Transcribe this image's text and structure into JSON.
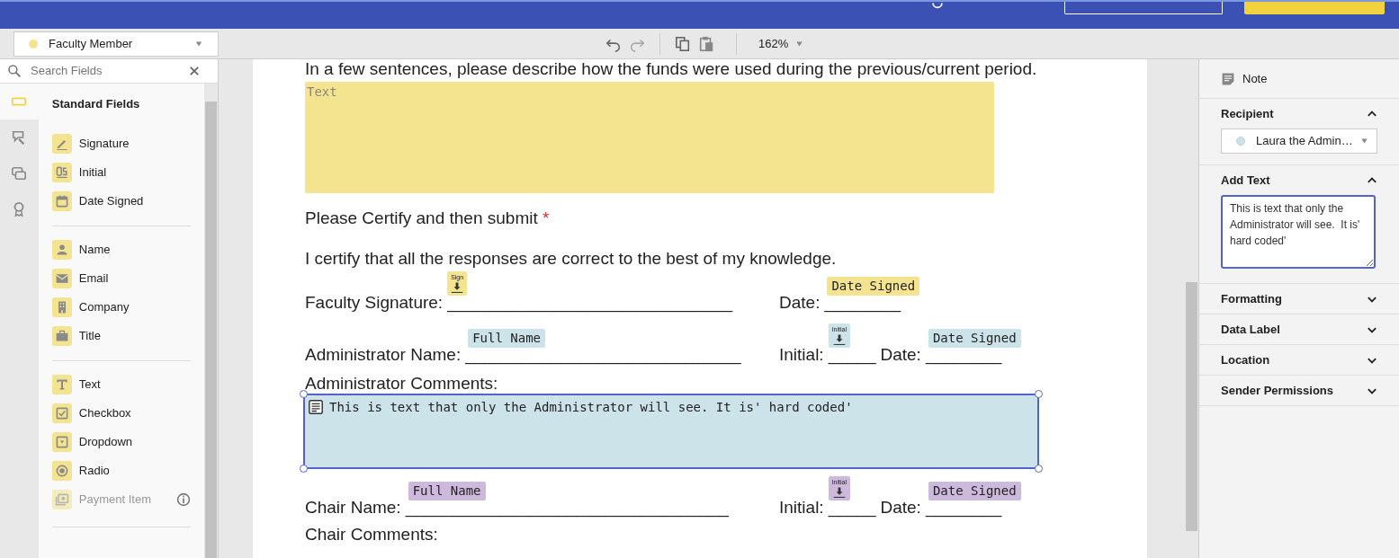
{
  "toolbar": {
    "recipient": {
      "label": "Faculty Member",
      "color": "#f4e48f"
    },
    "zoom": "162%"
  },
  "field_panel": {
    "search": {
      "placeholder": "Search Fields"
    },
    "rail": [
      {
        "selected": true
      },
      {
        "selected": false
      },
      {
        "selected": false
      },
      {
        "selected": false
      }
    ],
    "title": "Standard Fields",
    "groups": [
      {
        "items": [
          {
            "kind": "signature",
            "label": "Signature",
            "disabled": false
          },
          {
            "kind": "initial",
            "label": "Initial",
            "disabled": false
          },
          {
            "kind": "date",
            "label": "Date Signed",
            "disabled": false
          }
        ]
      },
      {
        "items": [
          {
            "kind": "name",
            "label": "Name",
            "disabled": false
          },
          {
            "kind": "email",
            "label": "Email",
            "disabled": false
          },
          {
            "kind": "company",
            "label": "Company",
            "disabled": false
          },
          {
            "kind": "title",
            "label": "Title",
            "disabled": false
          }
        ]
      },
      {
        "items": [
          {
            "kind": "text",
            "label": "Text",
            "disabled": false
          },
          {
            "kind": "checkbox",
            "label": "Checkbox",
            "disabled": false
          },
          {
            "kind": "dropdown",
            "label": "Dropdown",
            "disabled": false
          },
          {
            "kind": "radio",
            "label": "Radio",
            "disabled": false
          },
          {
            "kind": "payment",
            "label": "Payment Item",
            "disabled": true
          }
        ]
      }
    ]
  },
  "document": {
    "blocks": [
      {
        "kind": "paragraph",
        "text": "In a few sentences, please describe how the funds were used during the previous/current period."
      },
      {
        "kind": "text_field",
        "placeholder": "Text",
        "color": "#f4e48f"
      },
      {
        "kind": "question",
        "text": "Please Certify and then submit",
        "required_mark": "*"
      },
      {
        "kind": "paragraph",
        "text": "I certify that all the responses are correct to the best of my knowledge."
      },
      {
        "kind": "field_row",
        "groups": [
          {
            "segments": [
              {
                "kind": "label",
                "text": "Faculty Signature:"
              },
              {
                "kind": "blank",
                "text": "______________________________",
                "tag": {
                  "kind": "stamp",
                  "text": "Sign",
                  "color": "#f4e48f"
                }
              }
            ]
          },
          {
            "segments": [
              {
                "kind": "label",
                "text": "Date:"
              },
              {
                "kind": "blank",
                "text": "________",
                "tag": {
                  "kind": "tag",
                  "text": "Date Signed",
                  "color": "#f4e48f"
                }
              }
            ]
          }
        ]
      },
      {
        "kind": "field_row",
        "groups": [
          {
            "segments": [
              {
                "kind": "label",
                "text": "Administrator Name:"
              },
              {
                "kind": "blank",
                "text": "_____________________________",
                "tag": {
                  "kind": "tag",
                  "text": "Full Name",
                  "color": "#cde3ea"
                }
              }
            ]
          },
          {
            "segments": [
              {
                "kind": "label",
                "text": "Initial:"
              },
              {
                "kind": "blank",
                "text": "_____",
                "tag": {
                  "kind": "stamp",
                  "text": "Initial",
                  "color": "#cde3ea"
                }
              },
              {
                "kind": "label",
                "text": "Date:"
              },
              {
                "kind": "blank",
                "text": "________",
                "tag": {
                  "kind": "tag",
                  "text": "Date Signed",
                  "color": "#cde3ea"
                }
              }
            ]
          }
        ]
      },
      {
        "kind": "paragraph",
        "text": "Administrator Comments:"
      },
      {
        "kind": "note_field",
        "text": "This is text that only the Administrator will see. It is' hard coded'",
        "color": "#cde3ea",
        "selected": true
      },
      {
        "kind": "field_row",
        "groups": [
          {
            "segments": [
              {
                "kind": "label",
                "text": "Chair Name:"
              },
              {
                "kind": "blank",
                "text": "__________________________________",
                "tag": {
                  "kind": "tag",
                  "text": "Full Name",
                  "color": "#cdb9dc"
                }
              }
            ]
          },
          {
            "segments": [
              {
                "kind": "label",
                "text": "Initial:"
              },
              {
                "kind": "blank",
                "text": "_____",
                "tag": {
                  "kind": "stamp",
                  "text": "Initial",
                  "color": "#cdb9dc"
                }
              },
              {
                "kind": "label",
                "text": "Date:"
              },
              {
                "kind": "blank",
                "text": "________",
                "tag": {
                  "kind": "tag",
                  "text": "Date Signed",
                  "color": "#cdb9dc"
                }
              }
            ]
          }
        ]
      },
      {
        "kind": "paragraph",
        "text": "Chair Comments:"
      }
    ]
  },
  "properties": {
    "note": "Note",
    "sections": [
      {
        "kind": "recipient",
        "title": "Recipient",
        "expanded": true,
        "value": "Laura the Admin…",
        "color": "#cde3ea"
      },
      {
        "kind": "textarea",
        "title": "Add Text",
        "expanded": true,
        "value": "This is text that only the Administrator will see.  It is' hard coded'"
      },
      {
        "kind": "plain",
        "title": "Formatting",
        "expanded": false
      },
      {
        "kind": "plain",
        "title": "Data Label",
        "expanded": false
      },
      {
        "kind": "plain",
        "title": "Location",
        "expanded": false
      },
      {
        "kind": "plain",
        "title": "Sender Permissions",
        "expanded": false
      }
    ]
  }
}
